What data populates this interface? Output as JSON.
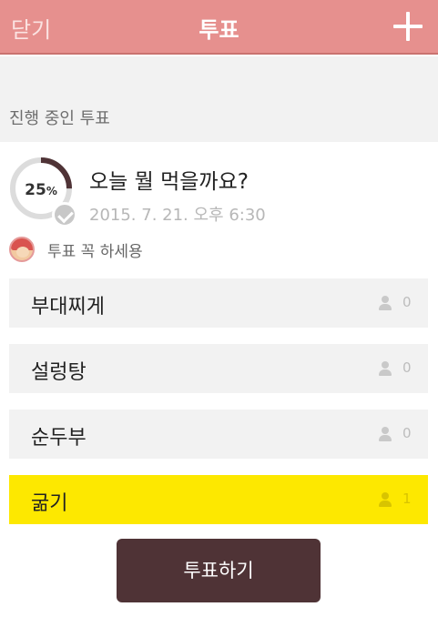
{
  "header": {
    "close_label": "닫기",
    "title": "투표",
    "add_icon": "plus-icon"
  },
  "section": {
    "title": "진행 중인 투표"
  },
  "poll": {
    "progress_value": 0.25,
    "progress_label": "25",
    "progress_unit": "%",
    "question": "오늘 뭘 먹을까요?",
    "date": "2015. 7. 21. 오후 6:30",
    "author_message": "투표 꼭 하세용",
    "options": [
      {
        "label": "부대찌게",
        "count": "0",
        "selected": false
      },
      {
        "label": "설렁탕",
        "count": "0",
        "selected": false
      },
      {
        "label": "순두부",
        "count": "0",
        "selected": false
      },
      {
        "label": "굶기",
        "count": "1",
        "selected": true
      }
    ],
    "vote_button": "투표하기"
  },
  "colors": {
    "header": "#e6908e",
    "progress_arc": "#4f3336",
    "selected_option": "#fde800",
    "vote_button": "#4f3336"
  }
}
